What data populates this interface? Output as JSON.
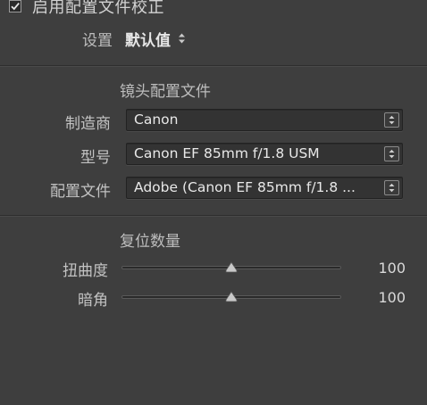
{
  "enable": {
    "label": "启用配置文件校正",
    "checked": true,
    "icon": "checkmark-icon"
  },
  "settings": {
    "label": "设置",
    "value": "默认值",
    "icon": "up-down-arrows-icon"
  },
  "lens_profile": {
    "title": "镜头配置文件",
    "fields": [
      {
        "label": "制造商",
        "value": "Canon"
      },
      {
        "label": "型号",
        "value": "Canon EF 85mm f/1.8 USM"
      },
      {
        "label": "配置文件",
        "value": "Adobe (Canon EF 85mm f/1.8 ..."
      }
    ]
  },
  "amount": {
    "title": "复位数量",
    "sliders": [
      {
        "label": "扭曲度",
        "value": "100",
        "level": 0.5
      },
      {
        "label": "暗角",
        "value": "100",
        "level": 0.5
      }
    ]
  },
  "colors": {
    "background": "#3e3e3e",
    "text": "#c9c9c9",
    "field_bg": "#333333"
  }
}
